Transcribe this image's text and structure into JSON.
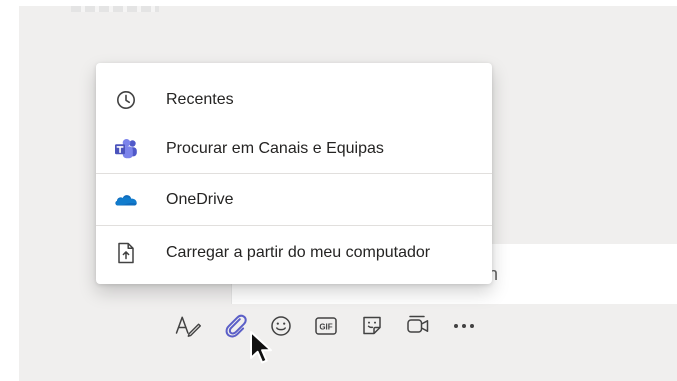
{
  "attach_menu": {
    "items": [
      {
        "label": "Recentes",
        "icon": "clock-icon"
      },
      {
        "label": "Procurar em Canais e Equipas",
        "icon": "teams-icon"
      },
      {
        "label": "OneDrive",
        "icon": "onedrive-cloud-icon"
      },
      {
        "label": "Carregar a partir do meu computador",
        "icon": "upload-file-icon"
      }
    ]
  },
  "compose": {
    "visible_tail_text": "n"
  },
  "toolbar": {
    "buttons": [
      {
        "name": "format",
        "icon": "format-pen-icon"
      },
      {
        "name": "attach",
        "icon": "paperclip-icon",
        "active": true
      },
      {
        "name": "emoji",
        "icon": "emoji-icon"
      },
      {
        "name": "gif",
        "icon": "gif-icon",
        "label": "GIF"
      },
      {
        "name": "sticker",
        "icon": "sticker-icon"
      },
      {
        "name": "meet-now",
        "icon": "video-camera-icon"
      },
      {
        "name": "more",
        "icon": "more-icon",
        "label": "•••"
      }
    ]
  },
  "colors": {
    "background": "#f0efee",
    "menu_background": "#ffffff",
    "text": "#252423",
    "icon_gray": "#424242",
    "active_accent": "#5b5fc7",
    "teams_purple": "#5059c9",
    "onedrive_blue": "#0f6cbd"
  }
}
